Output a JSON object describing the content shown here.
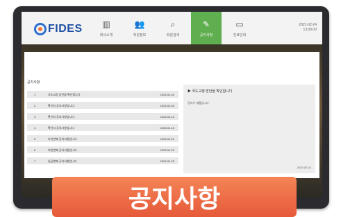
{
  "app": {
    "logo_text": "FIDES",
    "datetime_line1": "2021-02-24",
    "datetime_line2": "13:00:00"
  },
  "nav": {
    "items": [
      {
        "label": "회사소개",
        "icon": "building-icon"
      },
      {
        "label": "직원정보",
        "icon": "people-icon"
      },
      {
        "label": "회원검색",
        "icon": "search-icon"
      },
      {
        "label": "공지사항",
        "icon": "notice-icon",
        "active": true
      },
      {
        "label": "진료안내",
        "icon": "monitor-icon"
      }
    ]
  },
  "list": {
    "title": "공지사항",
    "rows": [
      {
        "num": "1",
        "title": "국도교정 방안을 확인합니다",
        "date": "2023-02-02"
      },
      {
        "num": "2",
        "title": "확인되 공지사항입니다.",
        "date": "2023-02-03"
      },
      {
        "num": "3",
        "title": "확인되 공지사항입니다.",
        "date": "2023-02-13"
      },
      {
        "num": "4",
        "title": "확인되 공지사항입니다.",
        "date": "2023-02-15"
      },
      {
        "num": "5",
        "title": "다섯번째 공지사항입니다.",
        "date": "2023-02-21"
      },
      {
        "num": "6",
        "title": "여섯번째 공지사항입니다.",
        "date": "2023-02-22"
      },
      {
        "num": "7",
        "title": "일곱번째 공지사항입니다.",
        "date": "2023-02-23"
      }
    ]
  },
  "detail": {
    "heading": "국도교정 방안을 확인합니다",
    "body": "공지가 새롭습니다.",
    "date": "2023-02-02"
  },
  "banner": {
    "text": "공지사항"
  }
}
